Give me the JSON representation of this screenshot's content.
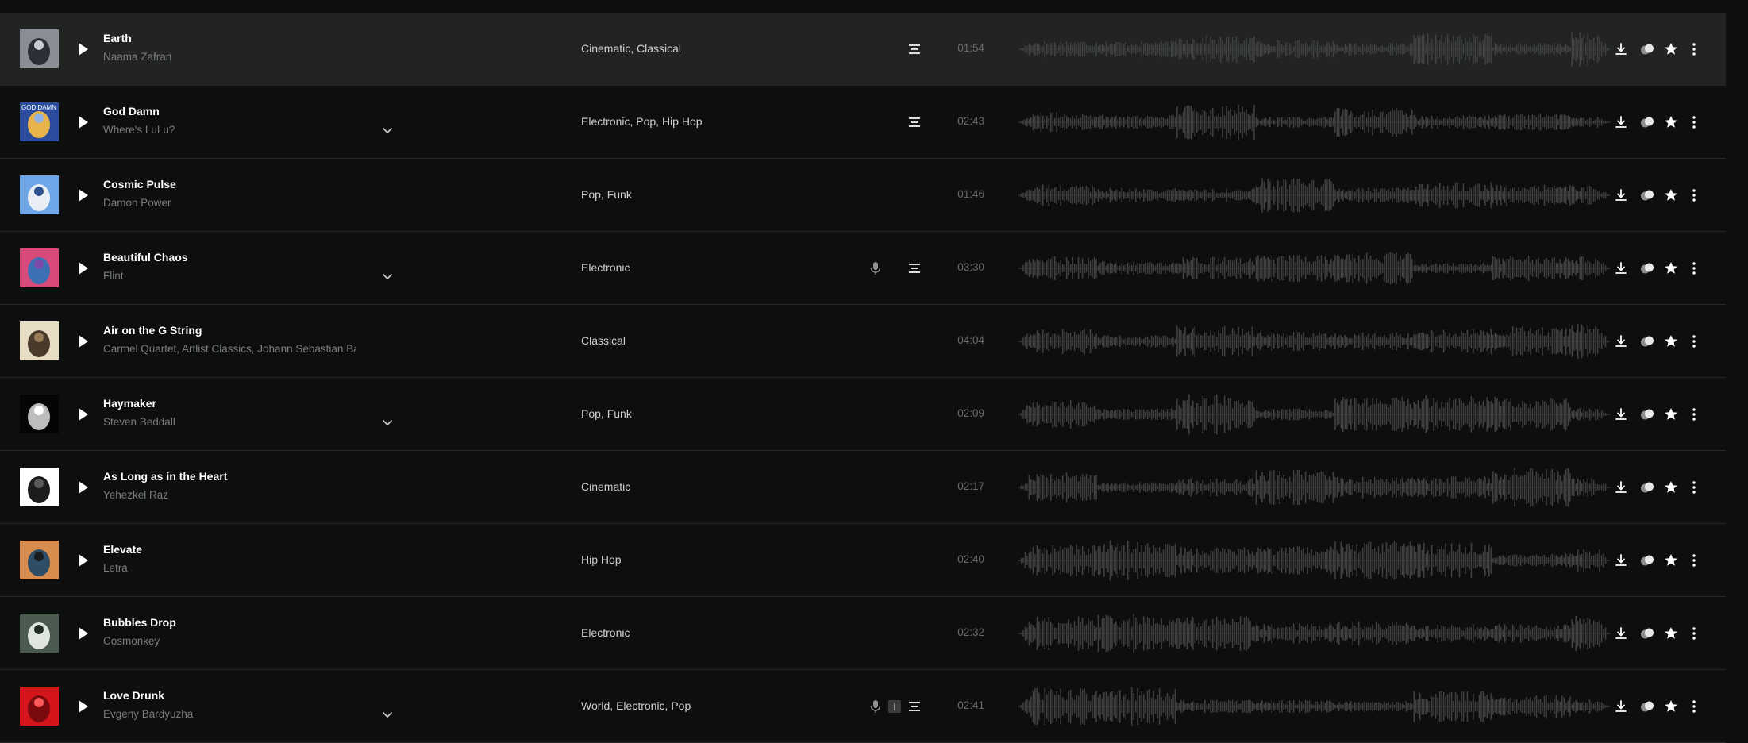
{
  "colors": {
    "background": "#0d0e0e",
    "active_row": "#222323",
    "divider": "#262828",
    "title_text": "#ffffff",
    "artist_text": "#7a7c7c",
    "genre_text": "#cfd1d1",
    "duration_text": "#6a6c6c",
    "waveform": "#3f4141"
  },
  "tracks": [
    {
      "title": "Earth",
      "artist": "Naama Zafran",
      "genres": "Cinematic, Classical",
      "duration": "01:54",
      "expand": false,
      "mic": false,
      "stems": false,
      "lyrics": true,
      "active": true,
      "art": [
        "#8a8f95",
        "#2b2f36",
        "#c9ccd0"
      ]
    },
    {
      "title": "God Damn",
      "artist": "Where's LuLu?",
      "genres": "Electronic, Pop, Hip Hop",
      "duration": "02:43",
      "expand": true,
      "mic": false,
      "stems": false,
      "lyrics": true,
      "active": false,
      "art": [
        "#2c4d9e",
        "#e7b34a",
        "#8fb3e6"
      ],
      "art_text": "GOD DAMN"
    },
    {
      "title": "Cosmic Pulse",
      "artist": "Damon Power",
      "genres": "Pop, Funk",
      "duration": "01:46",
      "expand": false,
      "mic": false,
      "stems": false,
      "lyrics": false,
      "active": false,
      "art": [
        "#6fa6e8",
        "#e9eef5",
        "#2b4f8f"
      ]
    },
    {
      "title": "Beautiful Chaos",
      "artist": "Flint",
      "genres": "Electronic",
      "duration": "03:30",
      "expand": true,
      "mic": true,
      "stems": false,
      "lyrics": true,
      "active": false,
      "art": [
        "#d84a7a",
        "#3c6fb3",
        "#7c4aa8"
      ]
    },
    {
      "title": "Air on the G String",
      "artist": "Carmel Quartet, Artlist Classics, Johann Sebastian Bach",
      "genres": "Classical",
      "duration": "04:04",
      "expand": false,
      "mic": false,
      "stems": false,
      "lyrics": false,
      "active": false,
      "art": [
        "#e7dcc4",
        "#4a3a2c",
        "#9b7d5a"
      ]
    },
    {
      "title": "Haymaker",
      "artist": "Steven Beddall",
      "genres": "Pop, Funk",
      "duration": "02:09",
      "expand": true,
      "mic": false,
      "stems": false,
      "lyrics": false,
      "active": false,
      "art": [
        "#050505",
        "#bdbdbd",
        "#ffffff"
      ]
    },
    {
      "title": "As Long as in the Heart",
      "artist": "Yehezkel Raz",
      "genres": "Cinematic",
      "duration": "02:17",
      "expand": false,
      "mic": false,
      "stems": false,
      "lyrics": false,
      "active": false,
      "art": [
        "#ffffff",
        "#1c1c1c",
        "#5b5b5b"
      ]
    },
    {
      "title": "Elevate",
      "artist": "Letra",
      "genres": "Hip Hop",
      "duration": "02:40",
      "expand": false,
      "mic": false,
      "stems": false,
      "lyrics": false,
      "active": false,
      "art": [
        "#d88d4e",
        "#2e4d66",
        "#1b1b1b"
      ]
    },
    {
      "title": "Bubbles Drop",
      "artist": "Cosmonkey",
      "genres": "Electronic",
      "duration": "02:32",
      "expand": false,
      "mic": false,
      "stems": false,
      "lyrics": false,
      "active": false,
      "art": [
        "#4b5a4e",
        "#dfe6e0",
        "#1f2a22"
      ]
    },
    {
      "title": "Love Drunk",
      "artist": "Evgeny Bardyuzha",
      "genres": "World, Electronic, Pop",
      "duration": "02:41",
      "expand": true,
      "mic": true,
      "stems": true,
      "lyrics": true,
      "active": false,
      "art": [
        "#d4151b",
        "#7a0a0e",
        "#ff5a5a"
      ]
    }
  ]
}
